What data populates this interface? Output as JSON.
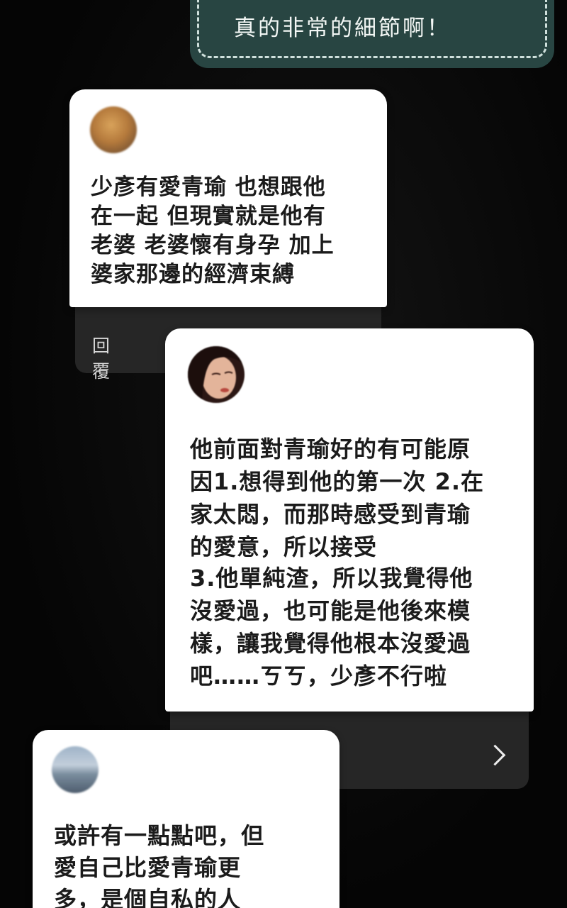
{
  "top_card": {
    "line": "真的非常的細節啊！"
  },
  "comments": [
    {
      "avatar": "avatar-blurred-orange",
      "text": "少彥有愛青瑜 也想跟他\n在一起 但現實就是他有\n老婆 老婆懷有身孕 加上\n婆家那邊的經濟束縛",
      "reply_label": "回覆"
    },
    {
      "avatar": "avatar-blurred-portrait",
      "text": "他前面對青瑜好的有可能原\n因1.想得到他的第一次 2.在\n家太悶，而那時感受到青瑜\n的愛意，所以接受",
      "text2": "3.他單純渣，所以我覺得他\n沒愛過，也可能是他後來模\n樣，讓我覺得他根本沒愛過\n吧……ㄎㄎ，少彥不行啦",
      "nav_icon": "chevron-right-icon"
    },
    {
      "avatar": "avatar-blurred-landscape",
      "text": "或許有一點點吧，但\n愛自己比愛青瑜更\n多，是個自私的人"
    }
  ]
}
